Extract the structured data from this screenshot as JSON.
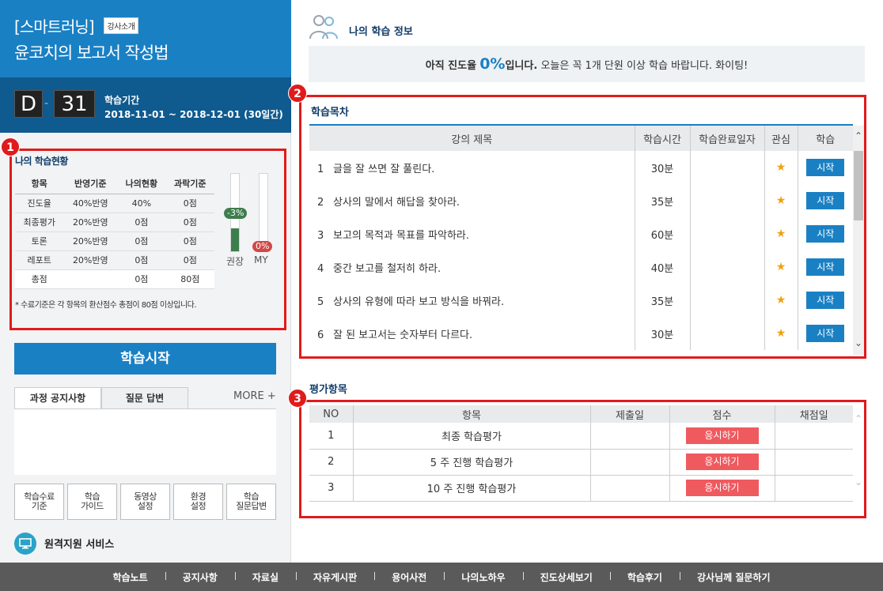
{
  "course": {
    "title_line1": "[스마트러닝]",
    "intro_badge": "강사소개",
    "title_line2": "윤코치의 보고서 작성법"
  },
  "dday": {
    "d_letter": "D",
    "dash": "-",
    "days": "31",
    "period_label": "학습기간",
    "period_value": "2018-11-01 ~ 2018-12-01 (30일간)"
  },
  "status": {
    "title": "나의 학습현황",
    "headers": [
      "항목",
      "반영기준",
      "나의현황",
      "과락기준"
    ],
    "rows": [
      [
        "진도율",
        "40%반영",
        "40%",
        "0점"
      ],
      [
        "최종평가",
        "20%반영",
        "0점",
        "0점"
      ],
      [
        "토론",
        "20%반영",
        "0점",
        "0점"
      ],
      [
        "레포트",
        "20%반영",
        "0점",
        "0점"
      ]
    ],
    "total": [
      "총점",
      "",
      "0점",
      "80점"
    ],
    "note": "* 수료기준은 각 항목의 환산점수 총점이 80점 이상입니다.",
    "gauge_recommended": {
      "label": "권장",
      "tag": "-3%",
      "fill_fraction": 0.3
    },
    "gauge_my": {
      "label": "MY",
      "tag": "0%",
      "fill_fraction": 0.13
    }
  },
  "start_button": "학습시작",
  "board_tabs": {
    "notice": "과정 공지사항",
    "qna": "질문 답변",
    "more": "MORE +"
  },
  "quick_buttons": [
    "학습수료\n기준",
    "학습\n가이드",
    "동영상\n설정",
    "환경\n설정",
    "학습\n질문답변"
  ],
  "remote_service": "원격지원 서비스",
  "info": {
    "title": "나의 학습 정보",
    "progress_prefix": "아직 진도율",
    "progress_pct": "0%",
    "progress_suffix": "입니다.",
    "progress_message": "오늘은 꼭 1개 단원 이상 학습 바랍니다. 화이팅!"
  },
  "toc": {
    "title": "학습목차",
    "headers": [
      "강의 제목",
      "학습시간",
      "학습완료일자",
      "관심",
      "학습"
    ],
    "rows": [
      {
        "num": "1",
        "title": "글을 잘 쓰면 잘 풀린다.",
        "time": "30분",
        "done": "",
        "action": "시작"
      },
      {
        "num": "2",
        "title": "상사의 말에서 해답을 찾아라.",
        "time": "35분",
        "done": "",
        "action": "시작"
      },
      {
        "num": "3",
        "title": "보고의 목적과 목표를 파악하라.",
        "time": "60분",
        "done": "",
        "action": "시작"
      },
      {
        "num": "4",
        "title": "중간 보고를 철저히 하라.",
        "time": "40분",
        "done": "",
        "action": "시작"
      },
      {
        "num": "5",
        "title": "상사의 유형에 따라 보고 방식을 바꿔라.",
        "time": "35분",
        "done": "",
        "action": "시작"
      },
      {
        "num": "6",
        "title": "잘 된 보고서는 숫자부터 다르다.",
        "time": "30분",
        "done": "",
        "action": "시작"
      }
    ]
  },
  "evaluation": {
    "title": "평가항목",
    "headers": [
      "NO",
      "항목",
      "제출일",
      "점수",
      "채점일"
    ],
    "rows": [
      {
        "no": "1",
        "item": "최종 학습평가",
        "submitted": "",
        "score": "응시하기",
        "graded": ""
      },
      {
        "no": "2",
        "item": "5 주 진행 학습평가",
        "submitted": "",
        "score": "응시하기",
        "graded": ""
      },
      {
        "no": "3",
        "item": "10 주 진행 학습평가",
        "submitted": "",
        "score": "응시하기",
        "graded": ""
      }
    ]
  },
  "annotations": [
    "1",
    "2",
    "3"
  ],
  "footer": [
    "학습노트",
    "공지사항",
    "자료실",
    "자유게시판",
    "용어사전",
    "나의노하우",
    "진도상세보기",
    "학습후기",
    "강사님께 질문하기"
  ]
}
